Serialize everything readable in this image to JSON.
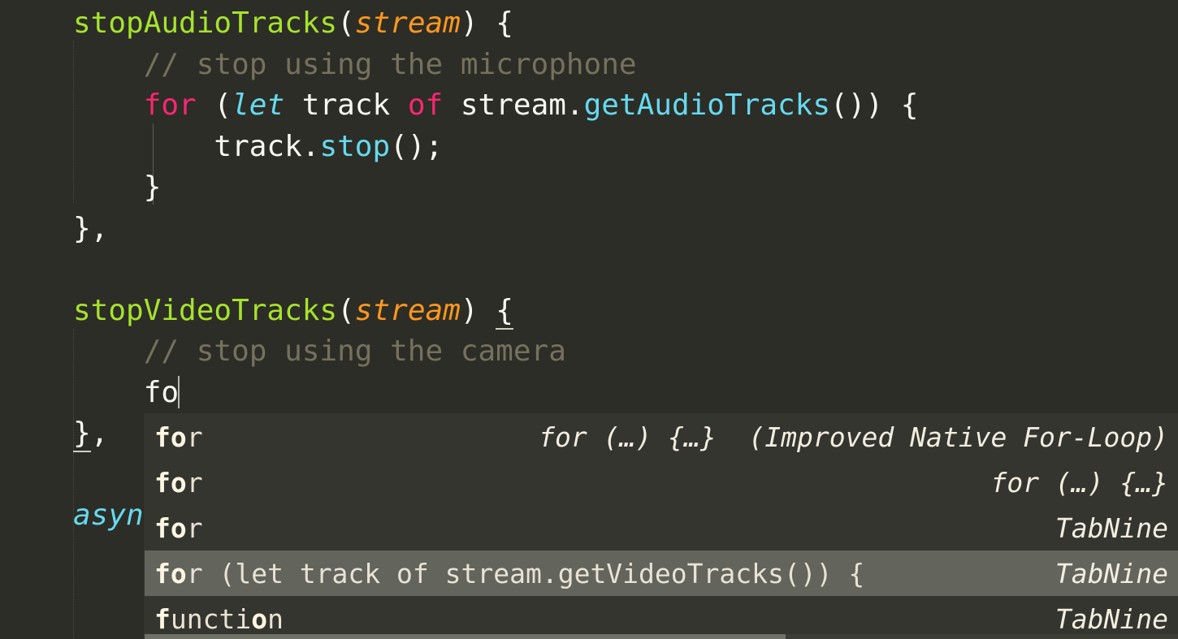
{
  "editor": {
    "theme_colors": {
      "background": "#2c2d26",
      "function_name": "#a6e22e",
      "parameter": "#fd971f",
      "keyword": "#f92672",
      "variable": "#66d9ef",
      "comment": "#75715e",
      "plain_text": "#f8f8f2",
      "popup_background": "#34352e",
      "popup_selected": "#63645c",
      "caret": "#b7b7ae"
    },
    "lines": [
      {
        "id": "line-1",
        "tokens": [
          {
            "text": "stopAudioTracks",
            "kind": "fn"
          },
          {
            "text": "(",
            "kind": "punc"
          },
          {
            "text": "stream",
            "kind": "param"
          },
          {
            "text": ") {",
            "kind": "punc"
          }
        ]
      },
      {
        "id": "line-2",
        "tokens": [
          {
            "text": "    // stop using the microphone",
            "kind": "comment"
          }
        ]
      },
      {
        "id": "line-3",
        "tokens": [
          {
            "text": "    ",
            "kind": "plain"
          },
          {
            "text": "for",
            "kind": "kw"
          },
          {
            "text": " (",
            "kind": "punc"
          },
          {
            "text": "let",
            "kind": "var"
          },
          {
            "text": " track ",
            "kind": "plain"
          },
          {
            "text": "of",
            "kind": "kw"
          },
          {
            "text": " stream.",
            "kind": "plain"
          },
          {
            "text": "getAudioTracks",
            "kind": "method"
          },
          {
            "text": "()) {",
            "kind": "punc"
          }
        ]
      },
      {
        "id": "line-4",
        "tokens": [
          {
            "text": "        track.",
            "kind": "plain"
          },
          {
            "text": "stop",
            "kind": "method"
          },
          {
            "text": "();",
            "kind": "punc"
          }
        ]
      },
      {
        "id": "line-5",
        "tokens": [
          {
            "text": "    }",
            "kind": "punc"
          }
        ]
      },
      {
        "id": "line-6",
        "tokens": [
          {
            "text": "},",
            "kind": "punc"
          }
        ]
      },
      {
        "id": "line-7",
        "tokens": []
      },
      {
        "id": "line-8",
        "tokens": [
          {
            "text": "stopVideoTracks",
            "kind": "fn"
          },
          {
            "text": "(",
            "kind": "punc"
          },
          {
            "text": "stream",
            "kind": "param"
          },
          {
            "text": ") ",
            "kind": "punc"
          },
          {
            "text": "{",
            "kind": "brace-match"
          }
        ]
      },
      {
        "id": "line-9",
        "tokens": [
          {
            "text": "    // stop using the camera",
            "kind": "comment"
          }
        ]
      },
      {
        "id": "line-10",
        "tokens": [
          {
            "text": "    fo",
            "kind": "plain"
          },
          {
            "text": "",
            "kind": "caret"
          }
        ]
      },
      {
        "id": "line-11",
        "tokens": [
          {
            "text": "}",
            "kind": "brace-match"
          },
          {
            "text": ",",
            "kind": "punc"
          }
        ]
      },
      {
        "id": "line-12",
        "tokens": []
      },
      {
        "id": "line-13",
        "tokens": [
          {
            "text": "async",
            "kind": "var"
          }
        ]
      }
    ]
  },
  "autocomplete": {
    "prefix": "fo",
    "items": [
      {
        "label_match": "fo",
        "label_rest": "r",
        "detail": "for (…) {…}  (Improved Native For-Loop)",
        "source": "",
        "selected": false,
        "align": "detail-center"
      },
      {
        "label_match": "fo",
        "label_rest": "r",
        "detail": "for (…) {…}",
        "source": "",
        "selected": false,
        "align": "right"
      },
      {
        "label_match": "fo",
        "label_rest": "r",
        "detail": "",
        "source": "TabNine",
        "selected": false,
        "align": "right"
      },
      {
        "label_match": "fo",
        "label_rest": "r (let track of stream.getVideoTracks()) {",
        "detail": "",
        "source": "TabNine",
        "selected": true,
        "align": "right"
      },
      {
        "label_match": "f",
        "label_rest": "unction",
        "label_match2": "o",
        "detail": "",
        "source": "TabNine",
        "selected": false,
        "align": "right"
      }
    ],
    "scrollbar": {
      "visible": true,
      "thumb_percent": 62
    }
  }
}
